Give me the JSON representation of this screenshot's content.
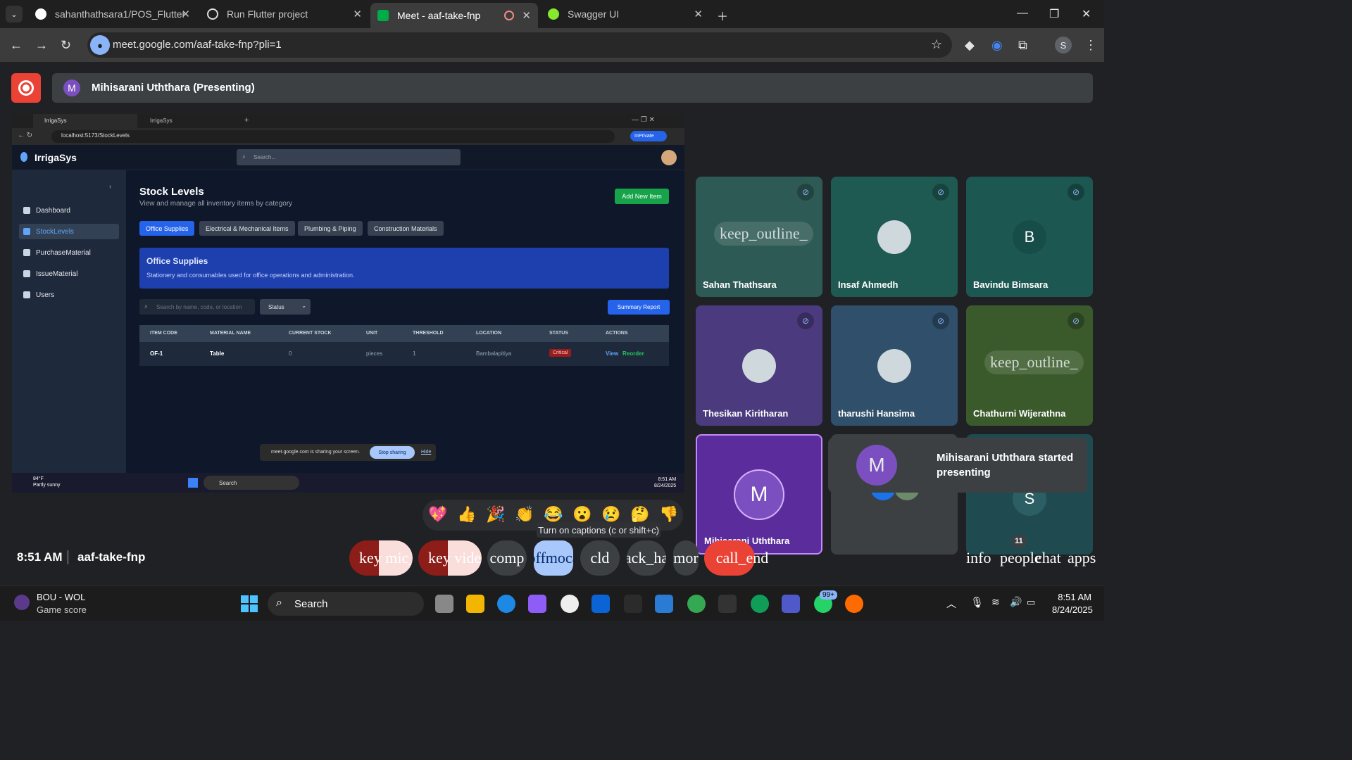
{
  "browser": {
    "tabs": [
      {
        "title": "sahanthathsara1/POS_Flutter",
        "active": false
      },
      {
        "title": "Run Flutter project",
        "active": false
      },
      {
        "title": "Meet - aaf-take-fnp",
        "active": true
      },
      {
        "title": "Swagger UI",
        "active": false
      }
    ],
    "url": "meet.google.com/aaf-take-fnp?pli=1",
    "profile_initial": "S"
  },
  "meet": {
    "presenter_initial": "M",
    "presenting_label": "Mihisarani Uththara (Presenting)",
    "time": "8:51 AM",
    "meeting_code": "aaf-take-fnp",
    "people_count": "11",
    "participants": [
      {
        "name": "Sahan Thathsara",
        "tile_text": "keep_outline_",
        "muted": true,
        "bg": "#2e5a55"
      },
      {
        "name": "Insaf Ahmedh",
        "muted": true,
        "bg": "#1f5a52"
      },
      {
        "name": "Bavindu Bimsara",
        "initial": "B",
        "muted": true,
        "bg": "#1d5752"
      },
      {
        "name": "Thesikan Kiritharan",
        "muted": true,
        "bg": "#4b3b7e"
      },
      {
        "name": "tharushi Hansima",
        "muted": true,
        "bg": "#2f4f6a"
      },
      {
        "name": "Chathurni Wijerathna",
        "tile_text": "keep_outline_",
        "muted": true,
        "bg": "#3a5a2c"
      },
      {
        "name": "Mihisarani Uththara",
        "initial": "M",
        "muted": false,
        "bg": "#5b2d9c"
      },
      {
        "name": "",
        "initial": "S",
        "muted": false,
        "bg": "#3c4043"
      },
      {
        "name": "",
        "initial": "S",
        "muted": true,
        "bg": "#1f4a50"
      }
    ],
    "toast": {
      "initial": "M",
      "text": "Mihisarani Uththara started presenting"
    },
    "tooltip": "Turn on captions (c or shift+c)",
    "reactions": [
      "💖",
      "👍",
      "🎉",
      "👏",
      "😂",
      "😮",
      "😢",
      "🤔",
      "👎"
    ],
    "controls": {
      "mic": "key mic_",
      "video": "key vide",
      "camera": "comp",
      "captions": "offmoca",
      "reaction": "cld",
      "hand": "back_han",
      "more": "mor",
      "end": "call_end",
      "info": "info",
      "people": "people",
      "chat": "chat",
      "apps": "apps"
    }
  },
  "shared_screen": {
    "tabs": [
      "IrrigaSys",
      "IrrigaSys"
    ],
    "url": "localhost:5173/StockLevels",
    "inprivate": "InPrivate",
    "app_name": "IrrigaSys",
    "search_placeholder": "Search...",
    "nav": [
      "Dashboard",
      "StockLevels",
      "PurchaseMaterial",
      "IssueMaterial",
      "Users"
    ],
    "page_title": "Stock Levels",
    "page_subtitle": "View and manage all inventory items by category",
    "add_button": "Add New Item",
    "categories": [
      "Office Supplies",
      "Electrical & Mechanical Items",
      "Plumbing & Piping",
      "Construction Materials"
    ],
    "banner_title": "Office Supplies",
    "banner_text": "Stationery and consumables used for office operations and administration.",
    "filter_placeholder": "Search by name, code, or location",
    "status_filter": "Status",
    "summary_button": "Summary Report",
    "columns": [
      "ITEM CODE",
      "MATERIAL NAME",
      "CURRENT STOCK",
      "UNIT",
      "THRESHOLD",
      "LOCATION",
      "STATUS",
      "ACTIONS"
    ],
    "row": {
      "code": "OF-1",
      "name": "Table",
      "stock": "0",
      "unit": "pieces",
      "threshold": "1",
      "location": "Bambalapitiya",
      "status": "Critical",
      "view": "View",
      "reorder": "Reorder"
    },
    "sharing_text": "meet.google.com is sharing your screen.",
    "stop_sharing": "Stop sharing",
    "hide": "Hide",
    "weather_temp": "84°F",
    "weather_desc": "Partly sunny",
    "taskbar_search": "Search",
    "clock_time": "8:51 AM",
    "clock_date": "8/24/2025"
  },
  "os_taskbar": {
    "widget_title": "BOU - WOL",
    "widget_sub": "Game score",
    "search": "Search",
    "whatsapp_badge": "99+",
    "time": "8:51 AM",
    "date": "8/24/2025"
  }
}
